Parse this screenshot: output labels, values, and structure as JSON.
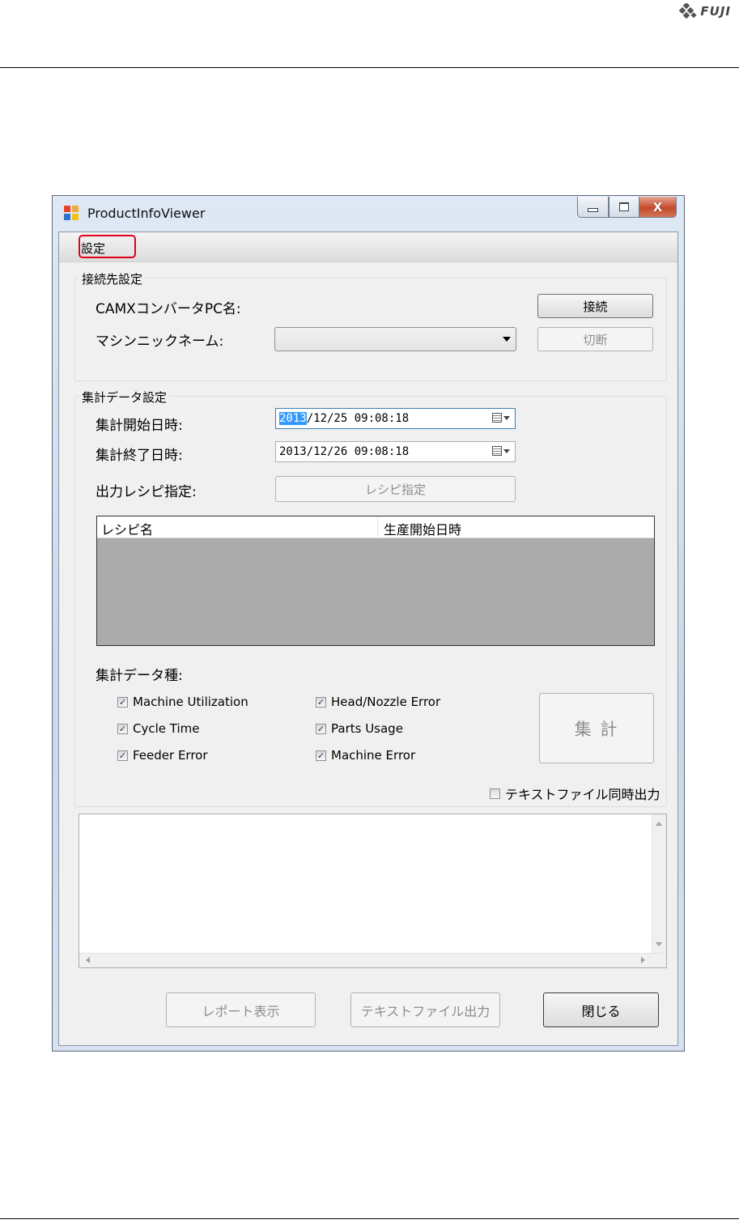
{
  "doc": {
    "brand": "FUJI"
  },
  "window": {
    "title": "ProductInfoViewer",
    "close_glyph": "X"
  },
  "menu": {
    "settings": "設定"
  },
  "connection": {
    "group_label": "接続先設定",
    "pc_name_label": "CAMXコンバータPC名:",
    "nickname_label": "マシンニックネーム:",
    "nickname_value": "",
    "connect_button": "接続",
    "disconnect_button": "切断"
  },
  "aggregate": {
    "group_label": "集計データ設定",
    "start_label": "集計開始日時:",
    "start_sel": "2013",
    "start_rest": "/12/25 09:08:18",
    "end_label": "集計終了日時:",
    "end_value": "2013/12/26 09:08:18",
    "recipe_label": "出力レシピ指定:",
    "recipe_button": "レシピ指定",
    "list_headers": [
      "レシピ名",
      "生産開始日時"
    ],
    "types_label": "集計データ種:",
    "checks": [
      {
        "label": "Machine Utilization",
        "checked": true
      },
      {
        "label": "Head/Nozzle Error",
        "checked": true
      },
      {
        "label": "Cycle Time",
        "checked": true
      },
      {
        "label": "Parts Usage",
        "checked": true
      },
      {
        "label": "Feeder Error",
        "checked": true
      },
      {
        "label": "Machine Error",
        "checked": true
      }
    ],
    "check_mark": "✓",
    "aggregate_button": "集 計",
    "text_simul_label": "テキストファイル同時出力",
    "text_simul_checked": false
  },
  "output": {
    "text": ""
  },
  "footer": {
    "report_button": "レポート表示",
    "text_output_button": "テキストファイル出力",
    "close_button": "閉じる"
  }
}
